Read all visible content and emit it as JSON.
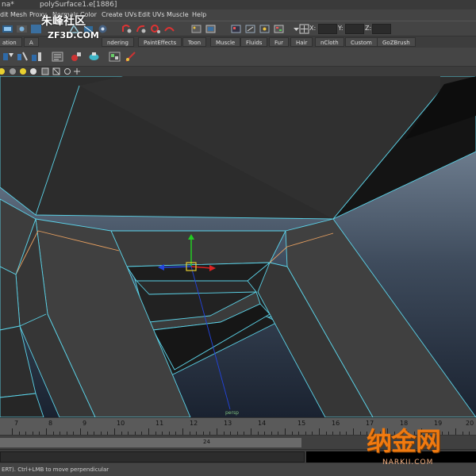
{
  "titlebar": {
    "left_fragment": "na*",
    "object": "polySurface1.e[1886]"
  },
  "menu": {
    "items": [
      "dit Mesh",
      "Proxy",
      "Normals",
      "Color",
      "Create UVs",
      "Edit UVs",
      "Muscle",
      "Help"
    ]
  },
  "status_line": {
    "x_label": "X:",
    "y_label": "Y:",
    "z_label": "Z:",
    "x_value": "",
    "y_value": "",
    "z_value": ""
  },
  "shelf": {
    "tabs": [
      "ation",
      "A",
      "ndering",
      "PaintEffects",
      "Toon",
      "Muscle",
      "Fluids",
      "Fur",
      "Hair",
      "nCloth",
      "Custom",
      "GoZBrush"
    ]
  },
  "viewport": {
    "camera_label": "persp"
  },
  "timeline": {
    "ticks": [
      "7",
      "8",
      "9",
      "10",
      "11",
      "12",
      "13",
      "14",
      "15",
      "16",
      "17",
      "18",
      "19",
      "20"
    ],
    "current_frame": "24"
  },
  "help_line": {
    "text": "ERT). Ctrl+LMB to move perpendicular"
  },
  "watermarks": {
    "top_cn": "朱峰社区",
    "top_en": "ZF3D.COM",
    "bottom_cn": "纳金网",
    "bottom_en": "NARKII.COM"
  },
  "colors": {
    "wire": "#5bd3e8",
    "selected_edge": "#e8a060",
    "axis_y": "#22cc22",
    "axis_x": "#dd2222",
    "axis_z": "#2244dd"
  }
}
